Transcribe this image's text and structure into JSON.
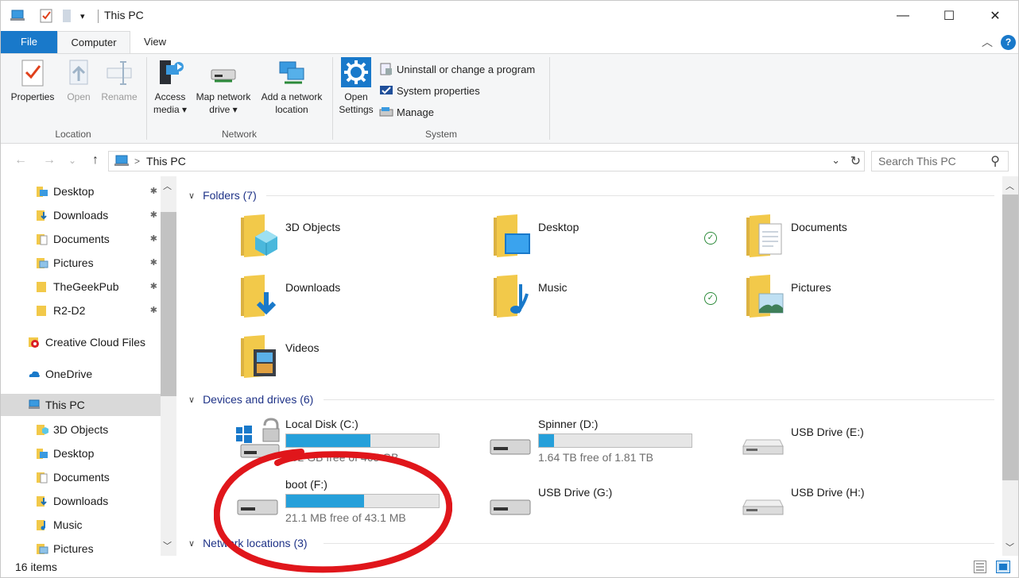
{
  "window": {
    "title": "This PC",
    "controls": {
      "minimize": "—",
      "maximize": "☐",
      "close": "✕"
    }
  },
  "quick_access": {
    "dropdown_glyph": "▾"
  },
  "ribbon_tabs": [
    {
      "label": "File"
    },
    {
      "label": "Computer"
    },
    {
      "label": "View"
    }
  ],
  "ribbon_help": {
    "collapse_glyph": "︿",
    "help_glyph": "?"
  },
  "ribbon": {
    "location": {
      "label": "Location",
      "buttons": [
        {
          "label": "Properties"
        },
        {
          "label": "Open"
        },
        {
          "label": "Rename"
        }
      ]
    },
    "network": {
      "label": "Network",
      "buttons": [
        {
          "line1": "Access",
          "line2": "media"
        },
        {
          "line1": "Map network",
          "line2": "drive"
        },
        {
          "line1": "Add a network",
          "line2": "location"
        }
      ],
      "dropdown_glyph": "▾"
    },
    "system": {
      "label": "System",
      "open_settings": {
        "line1": "Open",
        "line2": "Settings"
      },
      "items": [
        {
          "label": "Uninstall or change a program"
        },
        {
          "label": "System properties"
        },
        {
          "label": "Manage"
        }
      ]
    }
  },
  "address_bar": {
    "path": "This PC",
    "separator": ">",
    "search_placeholder": "Search This PC",
    "back_glyph": "←",
    "forward_glyph": "→",
    "recent_glyph": "⌄",
    "up_glyph": "↑",
    "dropdown_glyph": "⌄",
    "refresh_glyph": "↻",
    "search_glyph": "⚲"
  },
  "nav_pane": {
    "pinned": [
      {
        "label": "Desktop"
      },
      {
        "label": "Downloads"
      },
      {
        "label": "Documents"
      },
      {
        "label": "Pictures"
      },
      {
        "label": "TheGeekPub"
      },
      {
        "label": "R2-D2"
      }
    ],
    "pin_glyph": "✱",
    "roots": [
      {
        "label": "Creative Cloud Files"
      },
      {
        "label": "OneDrive"
      },
      {
        "label": "This PC"
      }
    ],
    "this_pc_children": [
      {
        "label": "3D Objects"
      },
      {
        "label": "Desktop"
      },
      {
        "label": "Documents"
      },
      {
        "label": "Downloads"
      },
      {
        "label": "Music"
      },
      {
        "label": "Pictures"
      }
    ],
    "scroll_up_glyph": "︿",
    "scroll_down_glyph": "﹀"
  },
  "content": {
    "folders_header": "Folders (7)",
    "folders": [
      {
        "name": "3D Objects"
      },
      {
        "name": "Desktop"
      },
      {
        "name": "Documents"
      },
      {
        "name": "Downloads"
      },
      {
        "name": "Music"
      },
      {
        "name": "Pictures"
      },
      {
        "name": "Videos"
      }
    ],
    "sync_glyph": "✓",
    "devices_header": "Devices and drives (6)",
    "drives": [
      {
        "name": "Local Disk (C:)",
        "free": "202 GB free of 465 GB",
        "used_fraction": 0.55
      },
      {
        "name": "Spinner (D:)",
        "free": "1.64 TB free of 1.81 TB",
        "used_fraction": 0.1
      },
      {
        "name": "USB Drive (E:)"
      },
      {
        "name": "boot (F:)",
        "free": "21.1 MB free of 43.1 MB",
        "used_fraction": 0.51
      },
      {
        "name": "USB Drive (G:)"
      },
      {
        "name": "USB Drive (H:)"
      }
    ],
    "network_header": "Network locations (3)",
    "collapse_glyph": "∨"
  },
  "status_bar": {
    "item_count": "16 items"
  },
  "colors": {
    "accent": "#1979ca",
    "usage_bar": "#26a0da",
    "section_header": "#1e3287",
    "folder_yellow": "#f2c94a",
    "annotation": "#e0161b"
  }
}
